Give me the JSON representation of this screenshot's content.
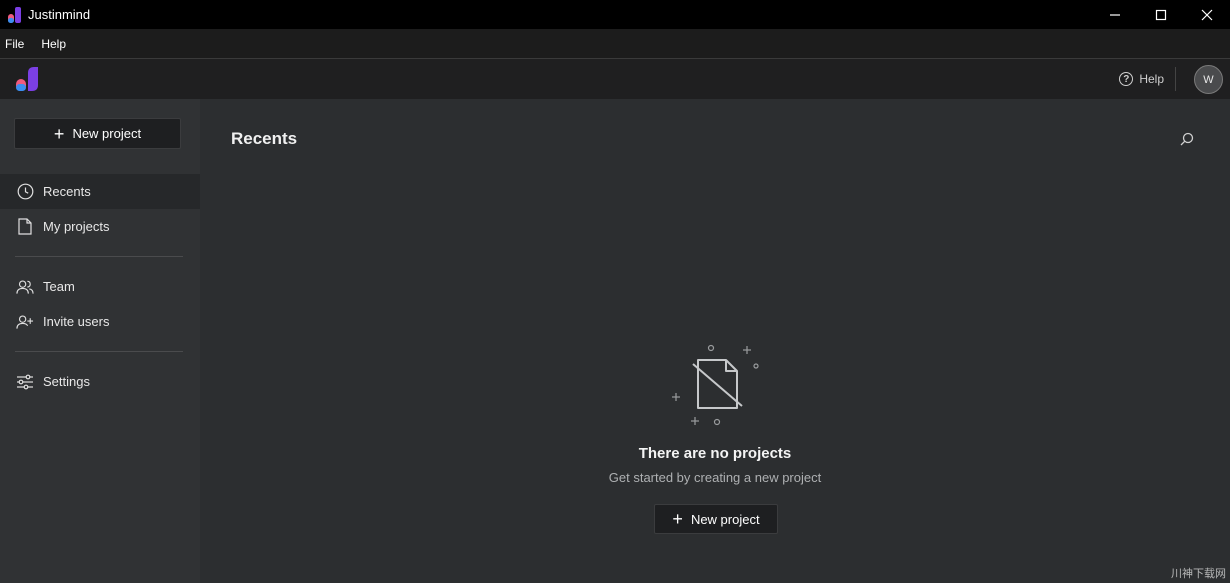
{
  "window": {
    "title": "Justinmind",
    "controls": {
      "minimize": "—",
      "maximize": "☐",
      "close": "✕"
    }
  },
  "menu": {
    "items": [
      "File",
      "Help"
    ]
  },
  "header": {
    "help_label": "Help",
    "avatar_initial": "W"
  },
  "sidebar": {
    "new_project_label": "New project",
    "items": [
      {
        "label": "Recents",
        "icon": "clock-icon",
        "active": true
      },
      {
        "label": "My projects",
        "icon": "document-icon",
        "active": false
      },
      {
        "label": "Team",
        "icon": "team-icon",
        "active": false
      },
      {
        "label": "Invite users",
        "icon": "invite-user-icon",
        "active": false
      },
      {
        "label": "Settings",
        "icon": "sliders-icon",
        "active": false
      }
    ]
  },
  "main": {
    "title": "Recents",
    "empty_state": {
      "title": "There are no projects",
      "subtitle": "Get started by creating a new project",
      "button_label": "New project"
    }
  },
  "watermark": "川神下载网",
  "colors": {
    "accent_purple": "#7b3fe4",
    "accent_pink": "#f05a7e",
    "accent_blue": "#3b8ef0",
    "sidebar_bg": "#303234",
    "main_bg": "#2c2e30"
  }
}
